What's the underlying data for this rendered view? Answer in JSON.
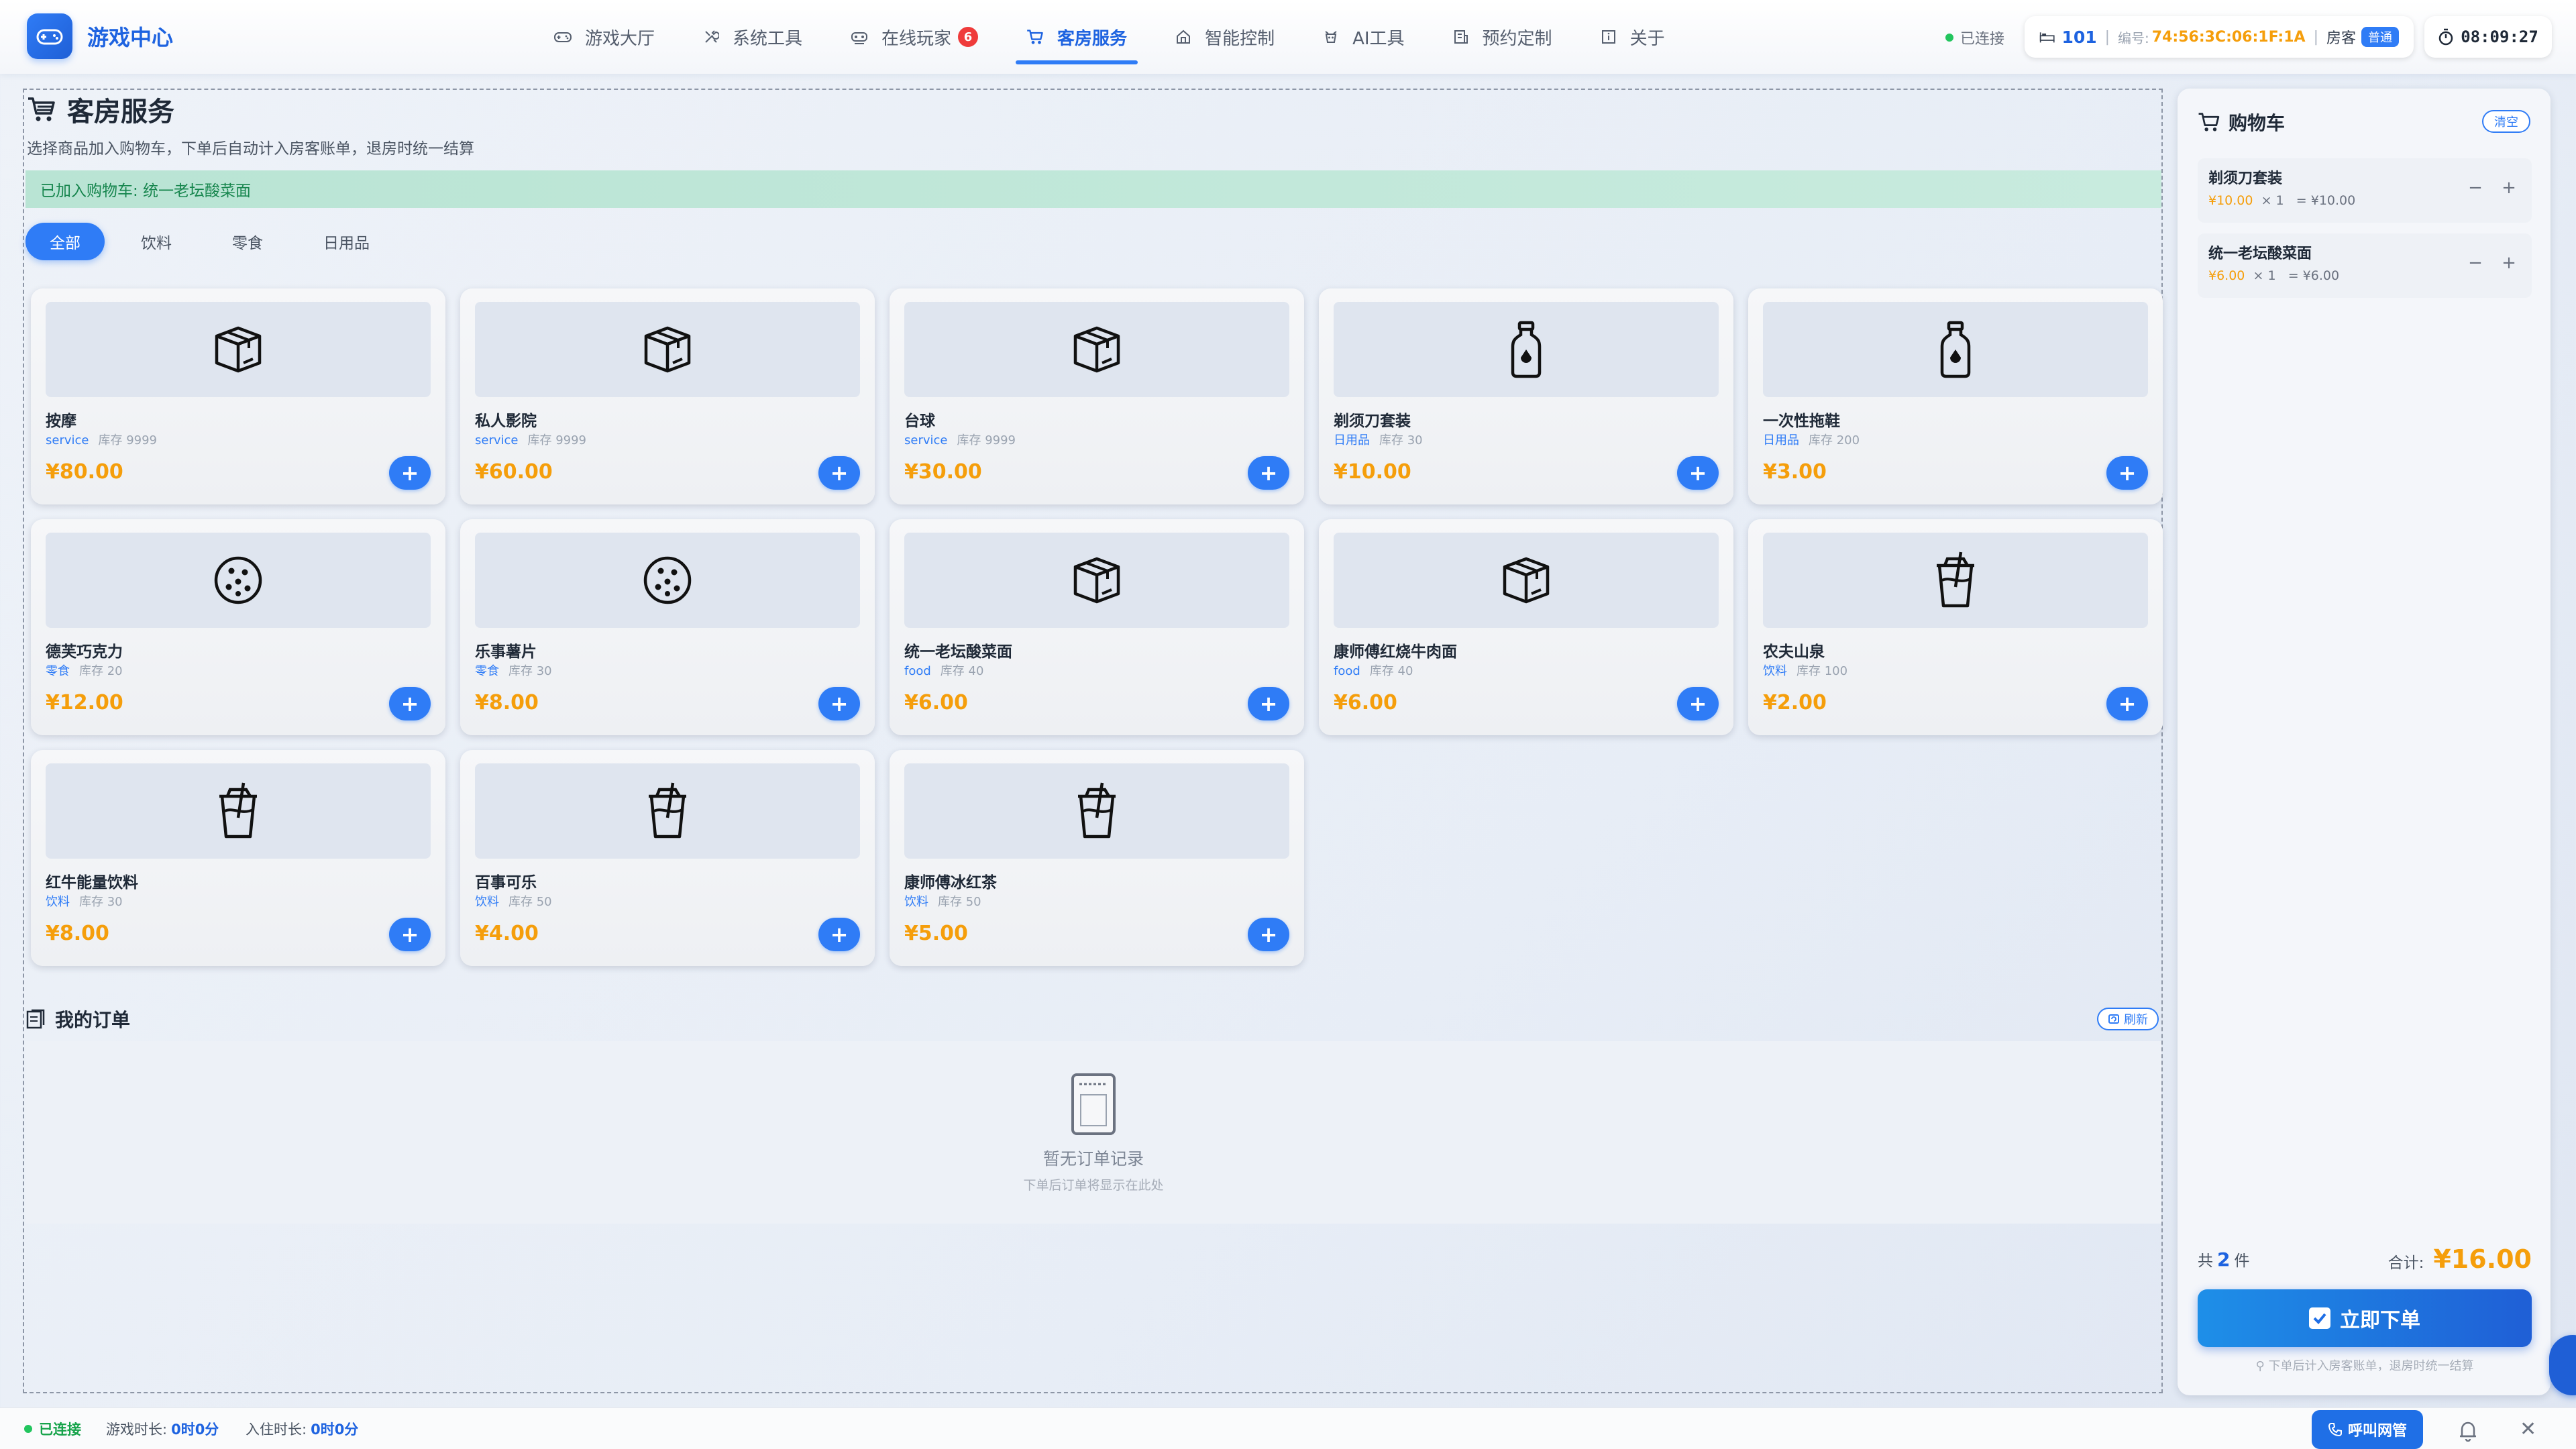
{
  "app": {
    "title": "游戏中心",
    "connection": "已连接"
  },
  "nav": [
    {
      "label": "游戏大厅",
      "icon": "gamepad-icon"
    },
    {
      "label": "系统工具",
      "icon": "tools-icon"
    },
    {
      "label": "在线玩家",
      "icon": "players-icon",
      "badge": "6"
    },
    {
      "label": "客房服务",
      "icon": "cart-icon",
      "active": true
    },
    {
      "label": "智能控制",
      "icon": "home-icon"
    },
    {
      "label": "AI工具",
      "icon": "robot-icon"
    },
    {
      "label": "预约定制",
      "icon": "building-icon"
    },
    {
      "label": "关于",
      "icon": "info-icon"
    }
  ],
  "room": {
    "number": "101",
    "mac_label": "编号:",
    "mac": "74:56:3C:06:1F:1A",
    "guest_label": "房客",
    "guest_level": "普通"
  },
  "clock": "08:09:27",
  "page": {
    "title": "客房服务",
    "subtitle": "选择商品加入购物车，下单后自动计入房客账单，退房时统一结算",
    "toast": "已加入购物车: 统一老坛酸菜面"
  },
  "filters": [
    "全部",
    "饮料",
    "零食",
    "日用品"
  ],
  "products": [
    {
      "name": "按摩",
      "category": "service",
      "stock": "库存 9999",
      "price": "¥80.00",
      "icon": "box-icon"
    },
    {
      "name": "私人影院",
      "category": "service",
      "stock": "库存 9999",
      "price": "¥60.00",
      "icon": "box-icon"
    },
    {
      "name": "台球",
      "category": "service",
      "stock": "库存 9999",
      "price": "¥30.00",
      "icon": "box-icon"
    },
    {
      "name": "剃须刀套装",
      "category": "日用品",
      "stock": "库存 30",
      "price": "¥10.00",
      "icon": "bottle-icon"
    },
    {
      "name": "一次性拖鞋",
      "category": "日用品",
      "stock": "库存 200",
      "price": "¥3.00",
      "icon": "bottle-icon"
    },
    {
      "name": "德芙巧克力",
      "category": "零食",
      "stock": "库存 20",
      "price": "¥12.00",
      "icon": "cookie-icon"
    },
    {
      "name": "乐事薯片",
      "category": "零食",
      "stock": "库存 30",
      "price": "¥8.00",
      "icon": "cookie-icon"
    },
    {
      "name": "统一老坛酸菜面",
      "category": "food",
      "stock": "库存 40",
      "price": "¥6.00",
      "icon": "box-icon"
    },
    {
      "name": "康师傅红烧牛肉面",
      "category": "food",
      "stock": "库存 40",
      "price": "¥6.00",
      "icon": "box-icon"
    },
    {
      "name": "农夫山泉",
      "category": "饮料",
      "stock": "库存 100",
      "price": "¥2.00",
      "icon": "cup-icon"
    },
    {
      "name": "红牛能量饮料",
      "category": "饮料",
      "stock": "库存 30",
      "price": "¥8.00",
      "icon": "cup-icon"
    },
    {
      "name": "百事可乐",
      "category": "饮料",
      "stock": "库存 50",
      "price": "¥4.00",
      "icon": "cup-icon"
    },
    {
      "name": "康师傅冰红茶",
      "category": "饮料",
      "stock": "库存 50",
      "price": "¥5.00",
      "icon": "cup-icon"
    }
  ],
  "add_label": "+",
  "orders": {
    "title": "我的订单",
    "refresh": "刷新",
    "empty": "暂无订单记录",
    "empty_sub": "下单后订单将显示在此处"
  },
  "cart": {
    "title": "购物车",
    "clear": "清空",
    "items": [
      {
        "name": "剃须刀套装",
        "price": "¥10.00",
        "qty": "× 1",
        "subtotal": "= ¥10.00"
      },
      {
        "name": "统一老坛酸菜面",
        "price": "¥6.00",
        "qty": "× 1",
        "subtotal": "= ¥6.00"
      }
    ],
    "count_prefix": "共",
    "count": "2",
    "count_suffix": "件",
    "total_label": "合计:",
    "total": "¥16.00",
    "order_button": "立即下单",
    "note": "下单后计入房客账单，退房时统一结算",
    "minus": "−",
    "plus": "+"
  },
  "bottom": {
    "connection": "已连接",
    "game_label": "游戏时长:",
    "game_value": "0时0分",
    "stay_label": "入住时长:",
    "stay_value": "0时0分",
    "call_button": "呼叫网管"
  },
  "colors": {
    "accent": "#2f7cf6",
    "price": "#f59e0b",
    "success": "#22c55e",
    "badge": "#ef3b3b"
  }
}
